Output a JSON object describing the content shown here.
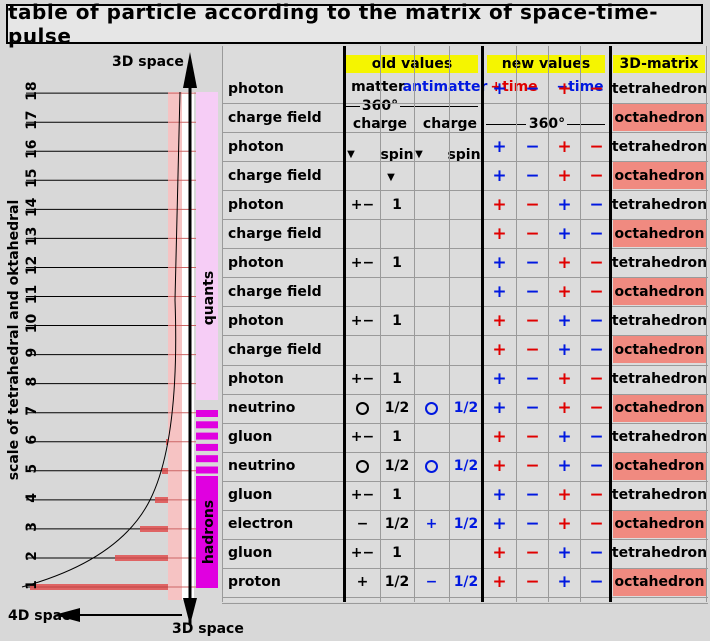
{
  "title": "table of particle according to the matrix of space-time-pulse",
  "left_axis": {
    "top_label": "3D space",
    "bottom_left_label": "4D space",
    "bottom_label": "3D space",
    "vertical_label": "scale of tetrahedral and oktahedral",
    "ticks": [
      "1",
      "2",
      "3",
      "4",
      "5",
      "6",
      "7",
      "8",
      "9",
      "10",
      "11",
      "12",
      "13",
      "14",
      "15",
      "16",
      "17",
      "18"
    ],
    "band_quants": "quants",
    "band_hadrons": "hadrons"
  },
  "headers": {
    "old_values": "old values",
    "new_values": "new values",
    "matrix": "3D-matrix",
    "matter": "matter",
    "antimatter": "antimatter",
    "plus_time": "+time",
    "minus_time": "−time",
    "deg_old": "360°",
    "deg_new": "360°",
    "charge1": "charge",
    "charge2": "charge",
    "spin1": "spin",
    "spin2": "spin"
  },
  "rows": [
    {
      "name": "photon",
      "mc": "",
      "ms": "",
      "ac": "",
      "as": "",
      "n": [
        "+",
        "−",
        "+",
        "−"
      ],
      "nc": [
        "b",
        "b",
        "r",
        "r"
      ],
      "matrix": "tetrahedron"
    },
    {
      "name": "charge field",
      "mc": "",
      "ms": "",
      "ac": "",
      "as": "",
      "n": [
        "",
        "",
        "",
        ""
      ],
      "nc": [
        "",
        "",
        "",
        ""
      ],
      "matrix": "octahedron"
    },
    {
      "name": "photon",
      "mc": "",
      "ms": "",
      "ac": "",
      "as": "",
      "n": [
        "+",
        "−",
        "+",
        "−"
      ],
      "nc": [
        "b",
        "b",
        "r",
        "r"
      ],
      "matrix": "tetrahedron"
    },
    {
      "name": "charge field",
      "mc": "",
      "ms": "",
      "ac": "",
      "as": "",
      "n": [
        "+",
        "−",
        "+",
        "−"
      ],
      "nc": [
        "b",
        "b",
        "r",
        "r"
      ],
      "matrix": "octahedron"
    },
    {
      "name": "photon",
      "mc": "+−",
      "ms": "1",
      "ac": "",
      "as": "",
      "n": [
        "+",
        "−",
        "+",
        "−"
      ],
      "nc": [
        "r",
        "r",
        "b",
        "b"
      ],
      "matrix": "tetrahedron"
    },
    {
      "name": "charge field",
      "mc": "",
      "ms": "",
      "ac": "",
      "as": "",
      "n": [
        "+",
        "−",
        "+",
        "−"
      ],
      "nc": [
        "r",
        "r",
        "b",
        "b"
      ],
      "matrix": "octahedron"
    },
    {
      "name": "photon",
      "mc": "+−",
      "ms": "1",
      "ac": "",
      "as": "",
      "n": [
        "+",
        "−",
        "+",
        "−"
      ],
      "nc": [
        "b",
        "b",
        "r",
        "r"
      ],
      "matrix": "tetrahedron"
    },
    {
      "name": "charge field",
      "mc": "",
      "ms": "",
      "ac": "",
      "as": "",
      "n": [
        "+",
        "−",
        "+",
        "−"
      ],
      "nc": [
        "b",
        "b",
        "r",
        "r"
      ],
      "matrix": "octahedron"
    },
    {
      "name": "photon",
      "mc": "+−",
      "ms": "1",
      "ac": "",
      "as": "",
      "n": [
        "+",
        "−",
        "+",
        "−"
      ],
      "nc": [
        "r",
        "r",
        "b",
        "b"
      ],
      "matrix": "tetrahedron"
    },
    {
      "name": "charge field",
      "mc": "",
      "ms": "",
      "ac": "",
      "as": "",
      "n": [
        "+",
        "−",
        "+",
        "−"
      ],
      "nc": [
        "r",
        "r",
        "b",
        "b"
      ],
      "matrix": "octahedron"
    },
    {
      "name": "photon",
      "mc": "+−",
      "ms": "1",
      "ac": "",
      "as": "",
      "n": [
        "+",
        "−",
        "+",
        "−"
      ],
      "nc": [
        "b",
        "b",
        "r",
        "r"
      ],
      "matrix": "tetrahedron"
    },
    {
      "name": "neutrino",
      "mc": "O",
      "ms": "1/2",
      "ac": "O",
      "as": "1/2",
      "n": [
        "+",
        "−",
        "+",
        "−"
      ],
      "nc": [
        "b",
        "b",
        "r",
        "r"
      ],
      "matrix": "octahedron"
    },
    {
      "name": "gluon",
      "mc": "+−",
      "ms": "1",
      "ac": "",
      "as": "",
      "n": [
        "+",
        "−",
        "+",
        "−"
      ],
      "nc": [
        "r",
        "r",
        "b",
        "b"
      ],
      "matrix": "tetrahedron"
    },
    {
      "name": "neutrino",
      "mc": "O",
      "ms": "1/2",
      "ac": "O",
      "as": "1/2",
      "n": [
        "+",
        "−",
        "+",
        "−"
      ],
      "nc": [
        "r",
        "r",
        "b",
        "b"
      ],
      "matrix": "octahedron"
    },
    {
      "name": "gluon",
      "mc": "+−",
      "ms": "1",
      "ac": "",
      "as": "",
      "n": [
        "+",
        "−",
        "+",
        "−"
      ],
      "nc": [
        "b",
        "b",
        "r",
        "r"
      ],
      "matrix": "tetrahedron"
    },
    {
      "name": "electron",
      "mc": "−",
      "ms": "1/2",
      "ac": "+",
      "as": "1/2",
      "n": [
        "+",
        "−",
        "+",
        "−"
      ],
      "nc": [
        "b",
        "b",
        "r",
        "r"
      ],
      "matrix": "octahedron"
    },
    {
      "name": "gluon",
      "mc": "+−",
      "ms": "1",
      "ac": "",
      "as": "",
      "n": [
        "+",
        "−",
        "+",
        "−"
      ],
      "nc": [
        "r",
        "r",
        "b",
        "b"
      ],
      "matrix": "tetrahedron"
    },
    {
      "name": "proton",
      "mc": "+",
      "ms": "1/2",
      "ac": "−",
      "as": "1/2",
      "n": [
        "+",
        "−",
        "+",
        "−"
      ],
      "nc": [
        "r",
        "r",
        "b",
        "b"
      ],
      "matrix": "octahedron"
    }
  ],
  "colors": {
    "red": "#e00000",
    "blue": "#0018e0",
    "yellow": "#f5f500",
    "salmon": "#f08a80",
    "pink": "#f4c8f4",
    "magenta": "#e000e0"
  }
}
